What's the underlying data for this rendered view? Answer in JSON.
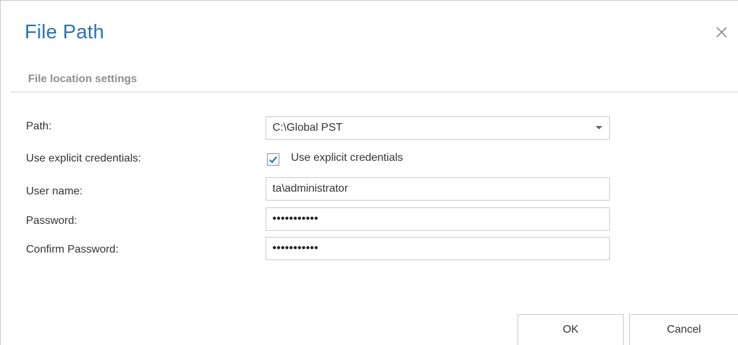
{
  "dialog": {
    "title": "File Path",
    "close_icon": "close-icon"
  },
  "section": {
    "title": "File location settings"
  },
  "form": {
    "path": {
      "label": "Path:",
      "value": "C:\\Global PST",
      "icon": "chevron-down-icon"
    },
    "explicit": {
      "label": "Use explicit credentials:",
      "checkbox_label": "Use explicit credentials",
      "checked": true
    },
    "username": {
      "label": "User name:",
      "value": "ta\\administrator"
    },
    "password": {
      "label": "Password:",
      "masked": "•••••••••••"
    },
    "confirm": {
      "label": "Confirm Password:",
      "masked": "•••••••••••"
    }
  },
  "buttons": {
    "ok": "OK",
    "cancel": "Cancel"
  },
  "colors": {
    "title": "#2b72b5",
    "check": "#2b72b5",
    "section": "#8f8f8f"
  }
}
